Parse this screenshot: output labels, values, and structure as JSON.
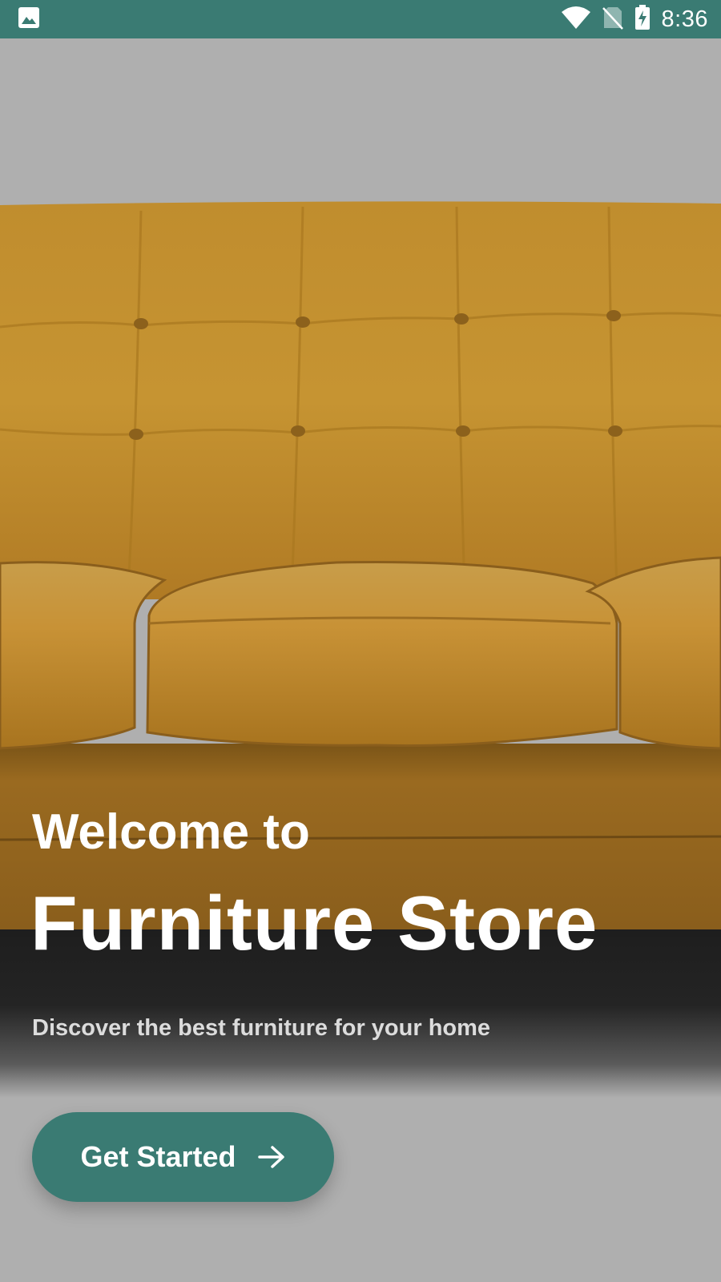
{
  "status_bar": {
    "time": "8:36",
    "background_color": "#3a7b73",
    "icons": [
      "image-icon",
      "wifi-icon",
      "no-sim-icon",
      "battery-charging-icon"
    ]
  },
  "hero": {
    "image": "yellow-tufted-sofa",
    "sofa_color": "#c8962e",
    "overlay_color": "#afafaf"
  },
  "welcome": {
    "line1": "Welcome to",
    "title": "Furniture Store",
    "tagline": "Discover the best furniture for your home"
  },
  "cta": {
    "label": "Get Started",
    "icon": "arrow-right-icon",
    "color": "#3a7b73"
  }
}
